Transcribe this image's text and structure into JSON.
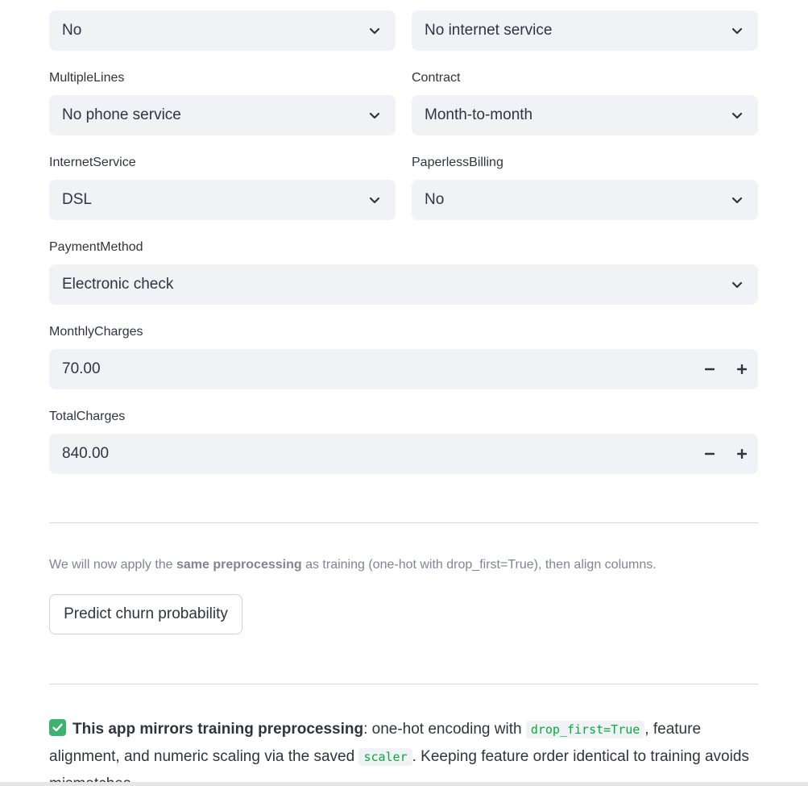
{
  "top_row": {
    "left_select": {
      "value": "No"
    },
    "right_select": {
      "value": "No internet service"
    }
  },
  "multiple_lines": {
    "label": "MultipleLines",
    "value": "No phone service"
  },
  "contract": {
    "label": "Contract",
    "value": "Month-to-month"
  },
  "internet_service": {
    "label": "InternetService",
    "value": "DSL"
  },
  "paperless_billing": {
    "label": "PaperlessBilling",
    "value": "No"
  },
  "payment_method": {
    "label": "PaymentMethod",
    "value": "Electronic check"
  },
  "monthly_charges": {
    "label": "MonthlyCharges",
    "value": "70.00",
    "minus": "−",
    "plus": "+"
  },
  "total_charges": {
    "label": "TotalCharges",
    "value": "840.00",
    "minus": "−",
    "plus": "+"
  },
  "caption": {
    "prefix": "We will now apply the ",
    "bold": "same preprocessing",
    "suffix": " as training (one-hot with drop_first=True), then align columns."
  },
  "predict_button": {
    "label": "Predict churn probability"
  },
  "note": {
    "bold": "This app mirrors training preprocessing",
    "part1": ": one-hot encoding with ",
    "code1": "drop_first=True",
    "part2": ", feature alignment, and numeric scaling via the saved ",
    "code2": "scaler",
    "part3": ". Keeping feature order identical to training avoids mismatches."
  },
  "colors": {
    "input_bg": "#f0f2f6",
    "text": "#31333f",
    "muted": "#808495",
    "code_text": "#09ab3b",
    "check_bg": "#3cb371"
  },
  "icons": {
    "dropdown": "chevron-down-icon",
    "decrement": "minus-icon",
    "increment": "plus-icon",
    "check": "check-mark-icon"
  }
}
